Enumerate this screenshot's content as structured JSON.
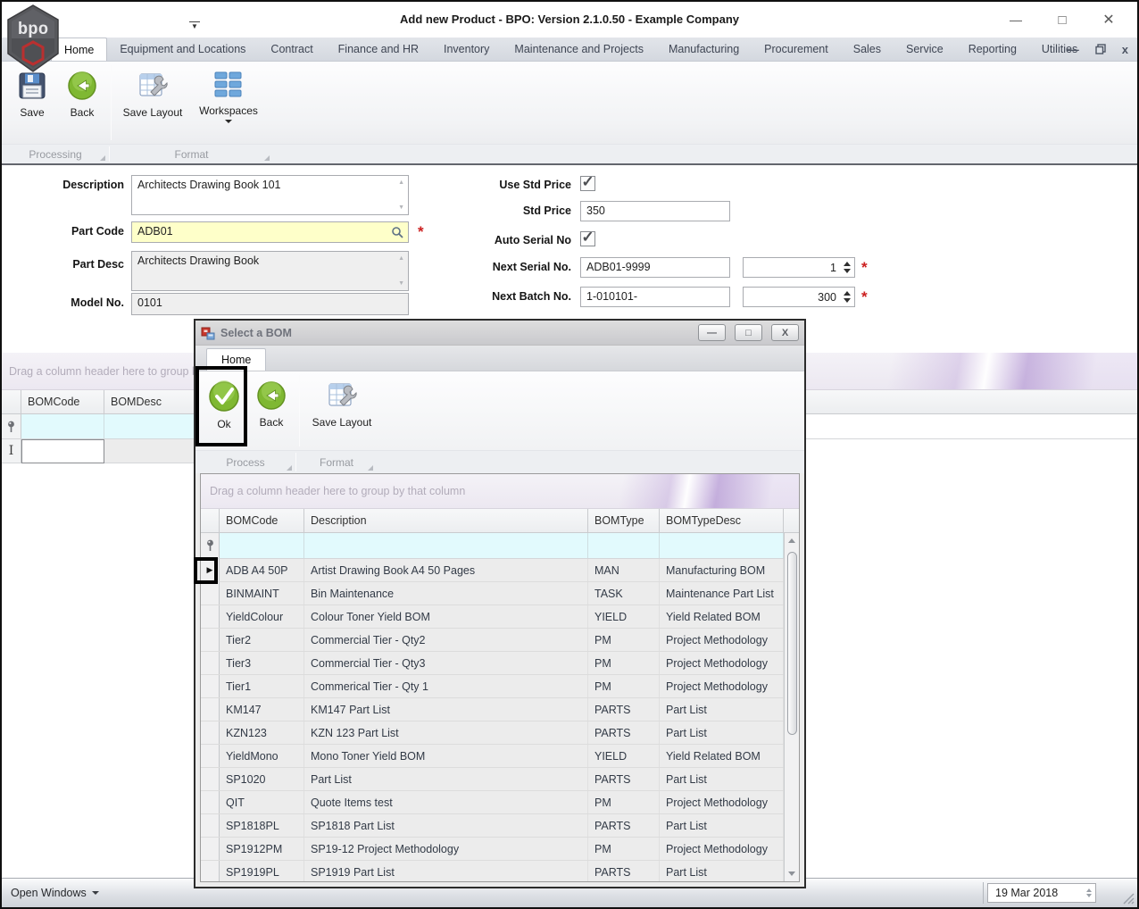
{
  "titlebar": {
    "title": "Add new Product - BPO: Version 2.1.0.50 - Example Company",
    "logo_text": "bpo"
  },
  "tabs": [
    {
      "label": "Home",
      "active": true
    },
    {
      "label": "Equipment and Locations",
      "active": false
    },
    {
      "label": "Contract",
      "active": false
    },
    {
      "label": "Finance and HR",
      "active": false
    },
    {
      "label": "Inventory",
      "active": false
    },
    {
      "label": "Maintenance and Projects",
      "active": false
    },
    {
      "label": "Manufacturing",
      "active": false
    },
    {
      "label": "Procurement",
      "active": false
    },
    {
      "label": "Sales",
      "active": false
    },
    {
      "label": "Service",
      "active": false
    },
    {
      "label": "Reporting",
      "active": false
    },
    {
      "label": "Utilities",
      "active": false
    }
  ],
  "ribbon": {
    "save": "Save",
    "back": "Back",
    "save_layout": "Save Layout",
    "workspaces": "Workspaces",
    "group_processing": "Processing",
    "group_format": "Format"
  },
  "form": {
    "description": {
      "label": "Description",
      "value": "Architects Drawing Book 101"
    },
    "part_code": {
      "label": "Part Code",
      "value": "ADB01",
      "required": true
    },
    "part_desc": {
      "label": "Part Desc",
      "value": "Architects Drawing Book"
    },
    "model_no": {
      "label": "Model No.",
      "value": "0101"
    },
    "use_std_price": {
      "label": "Use Std Price",
      "checked": true
    },
    "std_price": {
      "label": "Std Price",
      "value": "350"
    },
    "auto_serial": {
      "label": "Auto Serial No",
      "checked": true
    },
    "next_serial": {
      "label": "Next Serial No.",
      "value": "ADB01-9999",
      "qty": "1",
      "required": true
    },
    "next_batch": {
      "label": "Next Batch No.",
      "value": "1-010101-",
      "qty": "300",
      "required": true
    }
  },
  "main_grid": {
    "group_by_hint": "Drag a column header here to group by that column",
    "columns": [
      "BOMCode",
      "BOMDesc"
    ]
  },
  "modal": {
    "title": "Select a BOM",
    "tab": "Home",
    "ok": "Ok",
    "back": "Back",
    "save_layout": "Save Layout",
    "group_process": "Process",
    "group_format": "Format",
    "group_by_hint": "Drag a column header here to group by that column",
    "columns": [
      "BOMCode",
      "Description",
      "BOMType",
      "BOMTypeDesc"
    ],
    "rows": [
      [
        "ADB A4 50P",
        "Artist Drawing Book A4 50 Pages",
        "MAN",
        "Manufacturing BOM"
      ],
      [
        "BINMAINT",
        "Bin Maintenance",
        "TASK",
        "Maintenance Part List"
      ],
      [
        "YieldColour",
        "Colour Toner Yield BOM",
        "YIELD",
        "Yield Related BOM"
      ],
      [
        "Tier2",
        "Commercial Tier - Qty2",
        "PM",
        "Project Methodology"
      ],
      [
        "Tier3",
        "Commercial Tier - Qty3",
        "PM",
        "Project Methodology"
      ],
      [
        "Tier1",
        "Commerical Tier - Qty 1",
        "PM",
        "Project Methodology"
      ],
      [
        "KM147",
        "KM147 Part List",
        "PARTS",
        "Part List"
      ],
      [
        "KZN123",
        "KZN 123 Part List",
        "PARTS",
        "Part List"
      ],
      [
        "YieldMono",
        "Mono Toner Yield BOM",
        "YIELD",
        "Yield Related BOM"
      ],
      [
        "SP1020",
        "Part List",
        "PARTS",
        "Part List"
      ],
      [
        "QIT",
        "Quote Items test",
        "PM",
        "Project Methodology"
      ],
      [
        "SP1818PL",
        "SP1818 Part List",
        "PARTS",
        "Part List"
      ],
      [
        "SP1912PM",
        "SP19-12 Project Methodology",
        "PM",
        "Project Methodology"
      ],
      [
        "SP1919PL",
        "SP1919 Part List",
        "PARTS",
        "Part List"
      ]
    ]
  },
  "statusbar": {
    "open_windows": "Open Windows",
    "date": "19 Mar 2018"
  },
  "colors": {
    "accent_green": "#76b82a",
    "required_red": "#cc1f1f",
    "part_code_bg": "#feffc9",
    "filter_row_bg": "#e2fafd",
    "groupby_band": "#f1eef5"
  }
}
